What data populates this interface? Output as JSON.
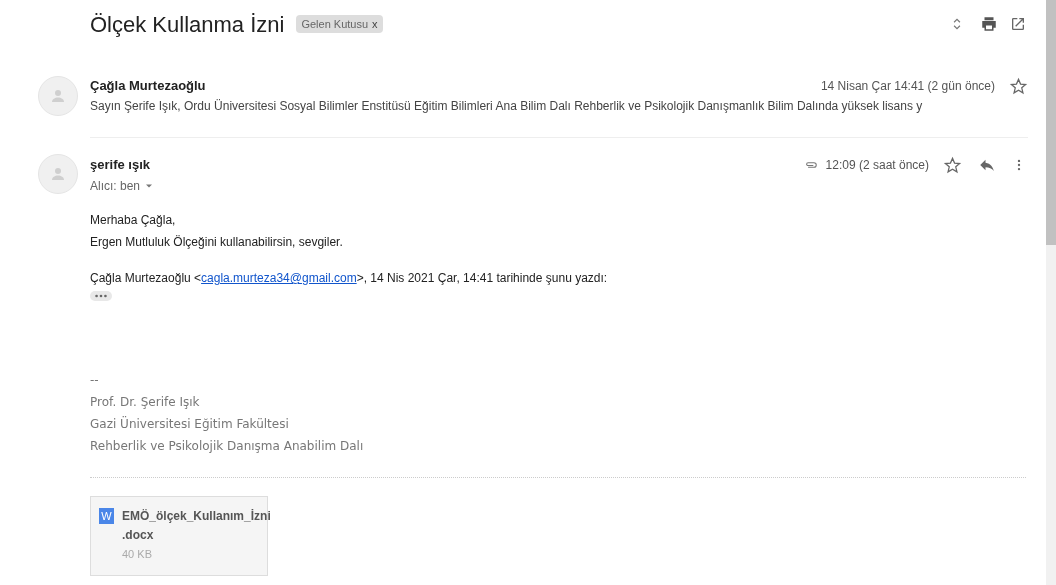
{
  "thread": {
    "subject": "Ölçek Kullanma İzni",
    "label": "Gelen Kutusu",
    "label_remove": "x"
  },
  "messages": [
    {
      "kind": "collapsed",
      "sender": "Çağla Murtezaoğlu",
      "time": "14 Nisan Çar 14:41 (2 gün önce)",
      "starred": false,
      "snippet": "Sayın Şerife Işık, Ordu Üniversitesi Sosyal Bilimler Enstitüsü Eğitim Bilimleri Ana Bilim Dalı Rehberlik ve Psikolojik Danışmanlık Bilim Dalında yüksek lisans y"
    },
    {
      "kind": "expanded",
      "sender": "şerife ışık",
      "time": "12:09 (2 saat önce)",
      "starred": false,
      "has_attachment": true,
      "recipient": "Alıcı: ben",
      "body": [
        "Merhaba Çağla,",
        "Ergen Mutluluk Ölçeğini kullanabilirsin, sevgiler."
      ],
      "quote": {
        "before": "Çağla Murtezaoğlu <",
        "link": "cagla.murteza34@gmail.com",
        "after": ">, 14 Nis 2021 Çar, 14:41 tarihinde şunu yazdı:"
      },
      "signature": [
        "--",
        "Prof. Dr. Şerife Işık",
        "Gazi Üniversitesi Eğitim Fakültesi",
        "Rehberlik ve Psikolojik Danışma Anabilim Dalı"
      ],
      "attachment": {
        "type_letter": "W",
        "name_line_1": "EMÖ_ölçek_Kullanım_İzni",
        "name_line_2": ".docx",
        "size": "40 KB"
      }
    }
  ]
}
